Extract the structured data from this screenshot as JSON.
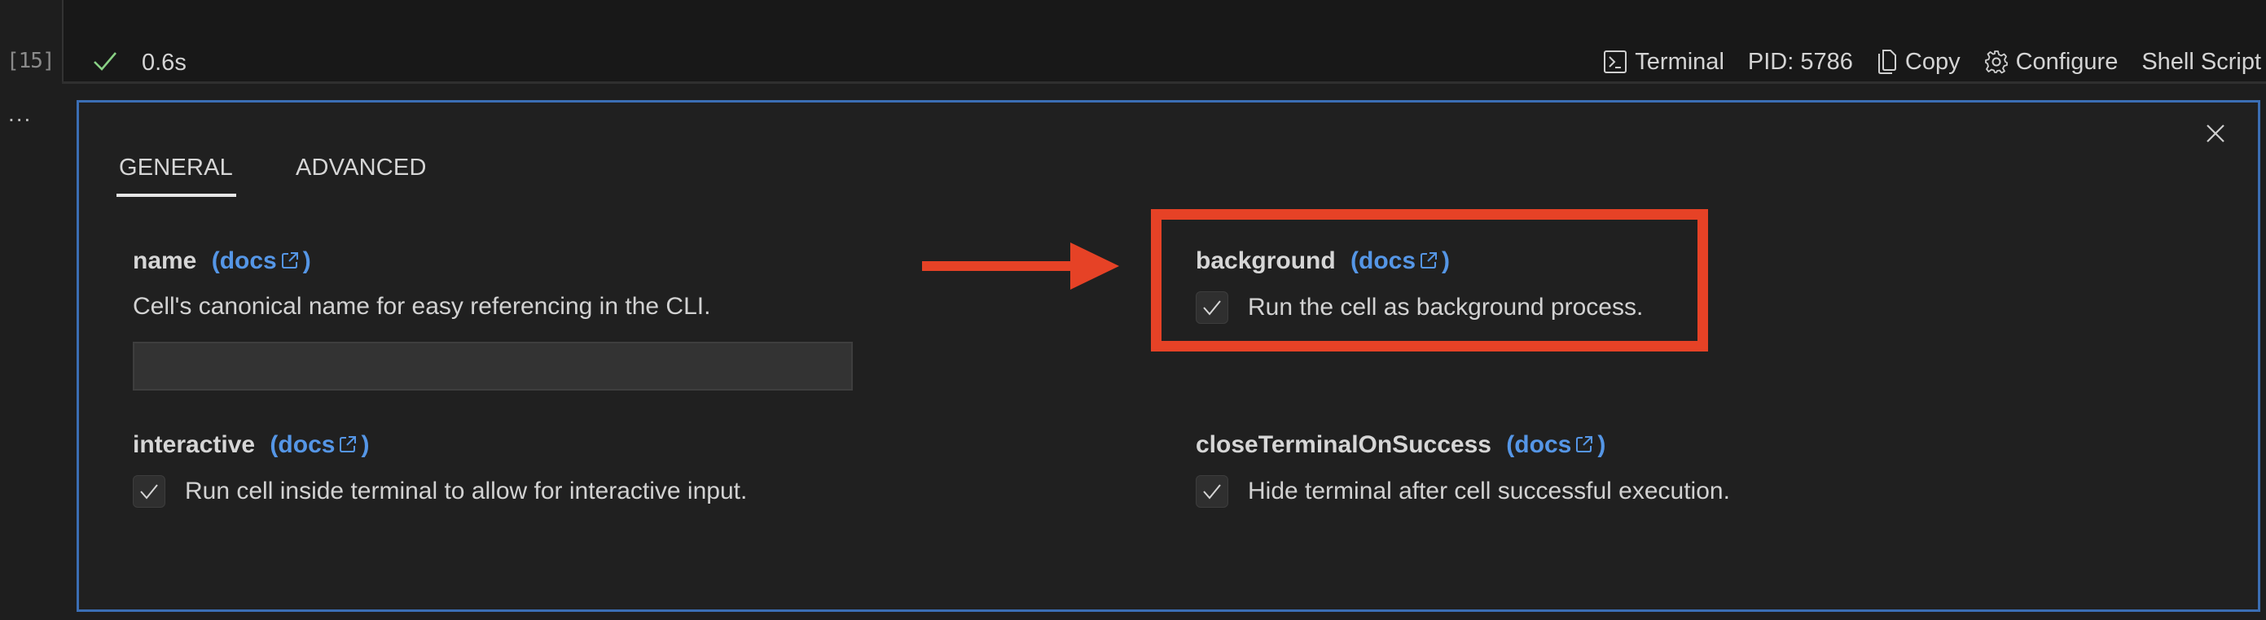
{
  "cell": {
    "execution_count": "[15]",
    "more_label": "...",
    "status": {
      "icon": "check-icon",
      "duration": "0.6s",
      "color": "#89d185"
    }
  },
  "toolbar": {
    "terminal": {
      "icon": "terminal-icon",
      "label": "Terminal"
    },
    "pid": "PID: 5786",
    "copy": {
      "icon": "copy-icon",
      "label": "Copy"
    },
    "configure": {
      "icon": "gear-icon",
      "label": "Configure"
    },
    "language": "Shell Script"
  },
  "config_panel": {
    "close_icon": "close-icon",
    "tabs": [
      {
        "label": "GENERAL",
        "active": true
      },
      {
        "label": "ADVANCED",
        "active": false
      }
    ],
    "fields": {
      "name": {
        "label": "name",
        "docs_label": "(docs",
        "docs_close": ")",
        "description": "Cell's canonical name for easy referencing in the CLI.",
        "value": "",
        "placeholder": ""
      },
      "background": {
        "label": "background",
        "docs_label": "(docs",
        "docs_close": ")",
        "checkbox_label": "Run the cell as background process.",
        "checked": true
      },
      "interactive": {
        "label": "interactive",
        "docs_label": "(docs",
        "docs_close": ")",
        "checkbox_label": "Run cell inside terminal to allow for interactive input.",
        "checked": true
      },
      "closeTerminalOnSuccess": {
        "label": "closeTerminalOnSuccess",
        "docs_label": "(docs",
        "docs_close": ")",
        "checkbox_label": "Hide terminal after cell successful execution.",
        "checked": true
      }
    }
  },
  "annotation": {
    "color": "#e64226",
    "target": "background",
    "shapes": [
      "arrow",
      "highlight-box"
    ]
  },
  "colors": {
    "accent_link": "#5596e6",
    "panel_border": "#3b6eb4",
    "background": "#1e1e1e"
  }
}
